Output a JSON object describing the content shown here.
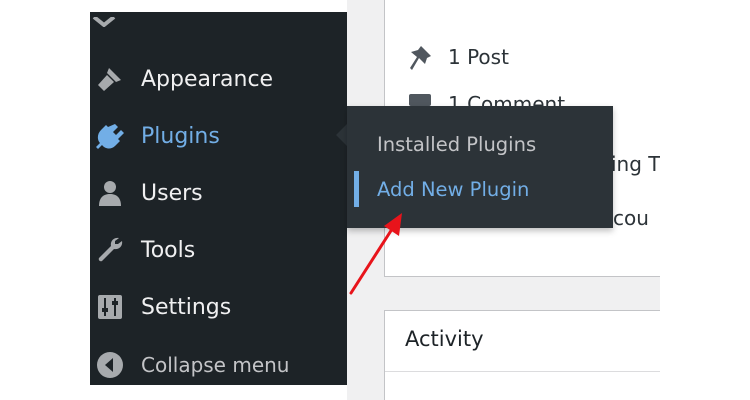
{
  "sidebar": {
    "items": [
      {
        "label": "Appearance",
        "icon": "paintbrush-icon"
      },
      {
        "label": "Plugins",
        "icon": "plugin-icon",
        "current": true
      },
      {
        "label": "Users",
        "icon": "users-icon"
      },
      {
        "label": "Tools",
        "icon": "wrench-icon"
      },
      {
        "label": "Settings",
        "icon": "settings-sliders-icon"
      }
    ],
    "collapse_label": "Collapse menu"
  },
  "flyout": {
    "items": [
      {
        "label": "Installed Plugins"
      },
      {
        "label": "Add New Plugin",
        "active": true
      }
    ]
  },
  "at_a_glance": {
    "posts": "1 Post",
    "comments": "1 Comment",
    "partial_line_1": "ing T",
    "partial_line_2": "iscou"
  },
  "activity": {
    "title": "Activity"
  },
  "colors": {
    "sidebar_bg": "#1d2327",
    "flyout_bg": "#2c3338",
    "accent": "#72aee6",
    "annotation_arrow": "#e8141b"
  }
}
